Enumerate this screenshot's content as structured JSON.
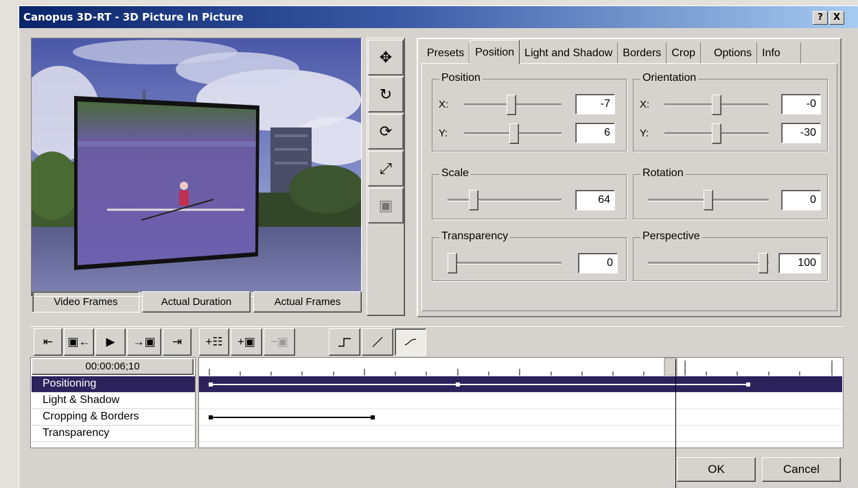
{
  "window": {
    "title": "Canopus 3D-RT - 3D Picture In Picture",
    "help_label": "?",
    "close_label": "X"
  },
  "preview_tabs": [
    "Video Frames",
    "Actual Duration",
    "Actual Frames"
  ],
  "tools": [
    {
      "name": "move-icon",
      "glyph": "✥"
    },
    {
      "name": "rotate-xy-icon",
      "glyph": "↻"
    },
    {
      "name": "rotate-z-icon",
      "glyph": "⟳"
    },
    {
      "name": "scale-icon",
      "glyph": "⤢"
    },
    {
      "name": "shadow-icon",
      "glyph": "▣"
    }
  ],
  "tabs": [
    "Presets",
    "Position",
    "Light and Shadow",
    "Borders",
    "Crop",
    "Options",
    "Info"
  ],
  "active_tab": "Position",
  "groups": {
    "position": {
      "label": "Position",
      "x_label": "X:",
      "y_label": "Y:",
      "x": "-7",
      "y": "6"
    },
    "orientation": {
      "label": "Orientation",
      "x_label": "X:",
      "y_label": "Y:",
      "x": "-0",
      "y": "-30"
    },
    "scale": {
      "label": "Scale",
      "value": "64"
    },
    "rotation": {
      "label": "Rotation",
      "value": "0"
    },
    "transparency": {
      "label": "Transparency",
      "value": "0"
    },
    "perspective": {
      "label": "Perspective",
      "value": "100"
    }
  },
  "playback": {
    "timecode": "00:00:06;10",
    "buttons": [
      "⇤",
      "▣←",
      "▶",
      "→▣",
      "⇥"
    ]
  },
  "keyframe_tools": [
    "+☷",
    "+▣",
    "−▣"
  ],
  "interp": [
    "step",
    "linear",
    "smooth"
  ],
  "tracks": [
    "Positioning",
    "Light & Shadow",
    "Cropping & Borders",
    "Transparency"
  ],
  "buttons": {
    "ok": "OK",
    "cancel": "Cancel"
  },
  "colors": {
    "title_start": "#0a246a",
    "title_end": "#a6caf0",
    "selected_row": "#2c225c",
    "face": "#d6d3ce"
  }
}
